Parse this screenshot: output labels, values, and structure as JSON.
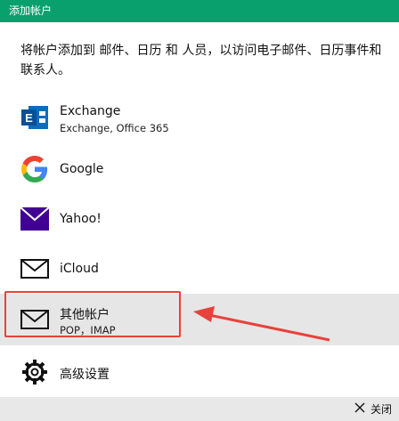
{
  "window": {
    "title": "添加帐户"
  },
  "intro": {
    "text": "将帐户添加到 邮件、日历 和 人员，以访问电子邮件、日历事件和联系人。"
  },
  "accounts": [
    {
      "icon": "exchange-icon",
      "label": "Exchange",
      "sublabel": "Exchange, Office 365"
    },
    {
      "icon": "google-icon",
      "label": "Google"
    },
    {
      "icon": "yahoo-mail-icon",
      "label": "Yahoo!"
    },
    {
      "icon": "mail-envelope-icon",
      "label": "iCloud"
    },
    {
      "icon": "mail-envelope-icon",
      "label": "其他帐户",
      "sublabel": "POP，IMAP",
      "highlighted": true
    },
    {
      "icon": "gear-icon",
      "label": "高级设置"
    }
  ],
  "footer": {
    "close_label": "关闭"
  },
  "colors": {
    "titlebar": "#0aa06e",
    "exchange": "#0f6cbd",
    "yahoo": "#410093",
    "annotation": "#e8423c",
    "highlight": "#e6e6e6"
  }
}
